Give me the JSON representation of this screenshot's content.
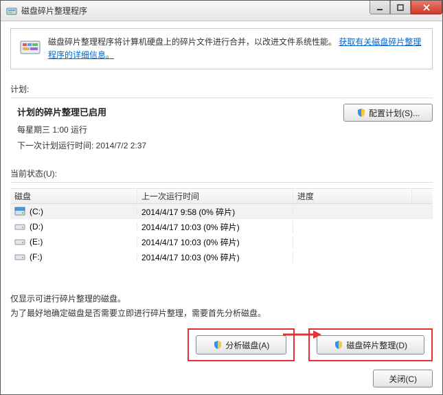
{
  "window": {
    "title": "磁盘碎片整理程序"
  },
  "banner": {
    "text": "磁盘碎片整理程序将计算机硬盘上的碎片文件进行合并，以改进文件系统性能。",
    "link": "获取有关磁盘碎片整理程序的详细信息。"
  },
  "schedule": {
    "section_label": "计划:",
    "title": "计划的碎片整理已启用",
    "line1": "每星期三  1:00 运行",
    "line2": "下一次计划运行时间: 2014/7/2 2:37",
    "configure_btn": "配置计划(S)..."
  },
  "status": {
    "section_label": "当前状态(U):",
    "columns": {
      "disk": "磁盘",
      "last": "上一次运行时间",
      "progress": "进度"
    },
    "rows": [
      {
        "name": "(C:)",
        "last": "2014/4/17 9:58 (0% 碎片)",
        "progress": "",
        "type": "os",
        "selected": true
      },
      {
        "name": "(D:)",
        "last": "2014/4/17 10:03 (0% 碎片)",
        "progress": "",
        "type": "hdd",
        "selected": false
      },
      {
        "name": "(E:)",
        "last": "2014/4/17 10:03 (0% 碎片)",
        "progress": "",
        "type": "hdd",
        "selected": false
      },
      {
        "name": "(F:)",
        "last": "2014/4/17 10:03 (0% 碎片)",
        "progress": "",
        "type": "hdd",
        "selected": false
      }
    ]
  },
  "notes": {
    "line1": "仅显示可进行碎片整理的磁盘。",
    "line2": "为了最好地确定磁盘是否需要立即进行碎片整理，需要首先分析磁盘。"
  },
  "actions": {
    "analyze": "分析磁盘(A)",
    "defrag": "磁盘碎片整理(D)",
    "close": "关闭(C)"
  }
}
